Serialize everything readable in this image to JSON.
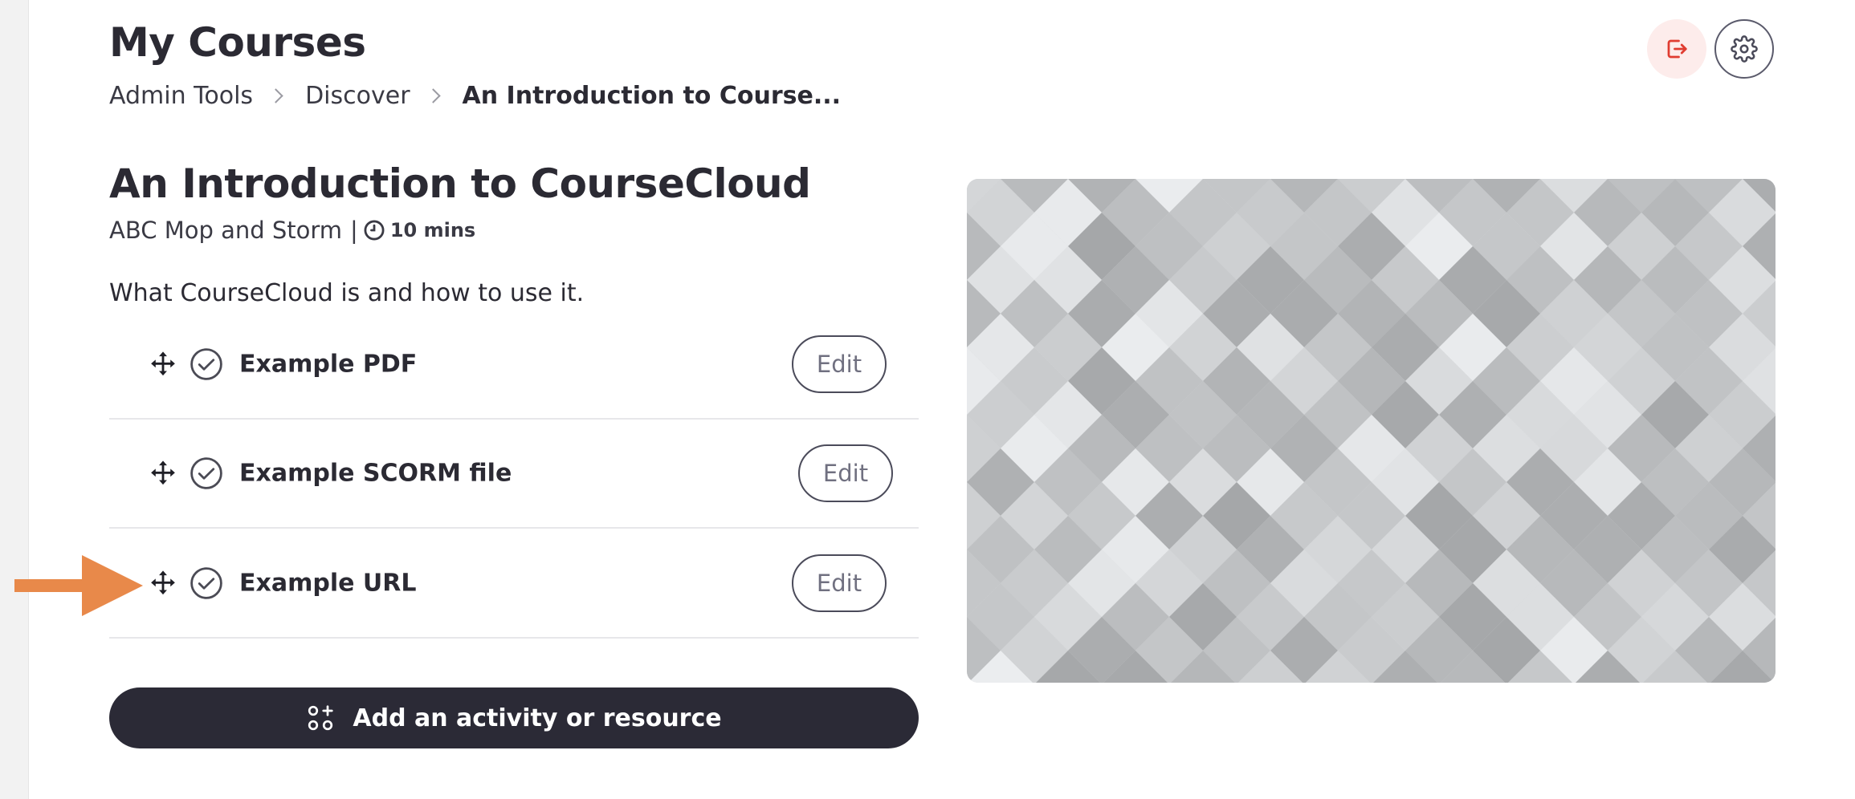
{
  "header": {
    "title": "My Courses",
    "breadcrumb": [
      "Admin Tools",
      "Discover",
      "An Introduction to Course..."
    ]
  },
  "actions": {
    "logout_icon": "logout-icon",
    "settings_icon": "gear-icon"
  },
  "course": {
    "title": "An Introduction to CourseCloud",
    "author": "ABC Mop and Storm",
    "separator": "|",
    "duration": "10 mins",
    "description": "What CourseCloud is and how to use it."
  },
  "activities": [
    {
      "label": "Example PDF",
      "edit_label": "Edit"
    },
    {
      "label": "Example SCORM file",
      "edit_label": "Edit"
    },
    {
      "label": "Example URL",
      "edit_label": "Edit"
    }
  ],
  "add_button": {
    "label": "Add an activity or resource"
  },
  "colors": {
    "dark": "#2b2a36",
    "logout_red": "#e03c31",
    "arrow_orange": "#e8894a"
  }
}
